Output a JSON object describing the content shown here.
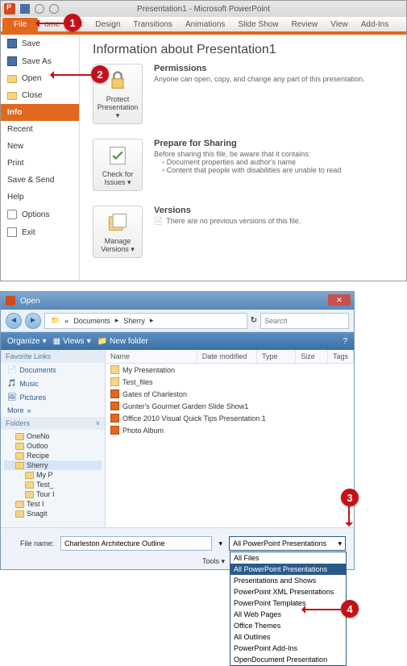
{
  "app": {
    "title": "Presentation1 - Microsoft PowerPoint",
    "tabs": [
      "File",
      "Home",
      "Insert",
      "Design",
      "Transitions",
      "Animations",
      "Slide Show",
      "Review",
      "View",
      "Add-Ins"
    ]
  },
  "backstage": {
    "items": [
      {
        "label": "Save"
      },
      {
        "label": "Save As"
      },
      {
        "label": "Open"
      },
      {
        "label": "Close"
      },
      {
        "label": "Info",
        "active": true
      },
      {
        "label": "Recent"
      },
      {
        "label": "New"
      },
      {
        "label": "Print"
      },
      {
        "label": "Save & Send"
      },
      {
        "label": "Help"
      },
      {
        "label": "Options"
      },
      {
        "label": "Exit"
      }
    ],
    "heading": "Information about Presentation1",
    "permissions": {
      "button": "Protect Presentation",
      "title": "Permissions",
      "desc": "Anyone can open, copy, and change any part of this presentation."
    },
    "prepare": {
      "button": "Check for Issues",
      "title": "Prepare for Sharing",
      "desc": "Before sharing this file, be aware that it contains:",
      "bullets": [
        "Document properties and author's name",
        "Content that people with disabilities are unable to read"
      ]
    },
    "versions": {
      "button": "Manage Versions",
      "title": "Versions",
      "desc": "There are no previous versions of this file."
    }
  },
  "openDialog": {
    "title": "Open",
    "breadcrumb": [
      "Documents",
      "Sherry"
    ],
    "searchPlaceholder": "Search",
    "toolbar": {
      "organize": "Organize",
      "views": "Views",
      "newfolder": "New folder"
    },
    "favHeader": "Favorite Links",
    "favs": [
      "Documents",
      "Music",
      "Pictures",
      "More"
    ],
    "foldersHeader": "Folders",
    "tree": [
      "OneNo",
      "Outloo",
      "Recipe",
      "Sherry",
      "My P",
      "Test_",
      "Tour I",
      "Test I",
      "Snagit"
    ],
    "columns": [
      "Name",
      "Date modified",
      "Type",
      "Size",
      "Tags"
    ],
    "files": [
      {
        "name": "My Presentation",
        "type": "folder"
      },
      {
        "name": "Test_files",
        "type": "folder"
      },
      {
        "name": "Gates of Charleston",
        "type": "ppt"
      },
      {
        "name": "Gunter's Gourmet Garden Slide Show1",
        "type": "ppt"
      },
      {
        "name": "Office 2010 Visual Quick Tips Presentation 1",
        "type": "ppt"
      },
      {
        "name": "Photo Album",
        "type": "ppt"
      }
    ],
    "fileNameLabel": "File name:",
    "fileNameValue": "Charleston Architecture Outline",
    "toolsLabel": "Tools",
    "typeSelected": "All PowerPoint Presentations",
    "typeOptions": [
      "All PowerPoint Presentations",
      "All Files",
      "All PowerPoint Presentations",
      "Presentations and Shows",
      "PowerPoint XML Presentations",
      "PowerPoint Templates",
      "All Web Pages",
      "Office Themes",
      "All Outlines",
      "PowerPoint Add-Ins",
      "OpenDocument Presentation"
    ]
  },
  "callouts": {
    "c1": "1",
    "c2": "2",
    "c3": "3",
    "c4": "4"
  }
}
